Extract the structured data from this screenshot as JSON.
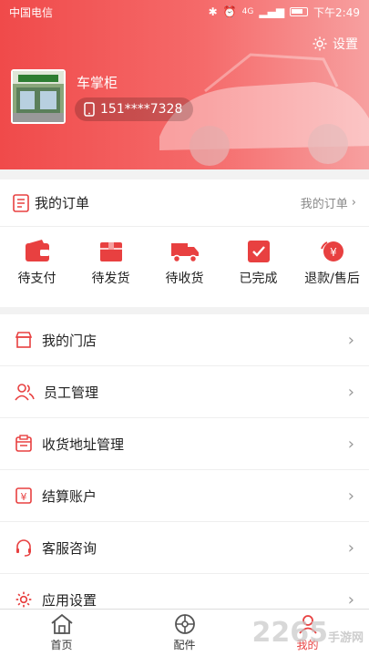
{
  "colors": {
    "accent": "#e84040",
    "header_start": "#f04a4a",
    "header_end": "#f7a0a0"
  },
  "status_bar": {
    "carrier": "中国电信",
    "time": "下午2:49",
    "network": "4G"
  },
  "header": {
    "settings_label": "设置",
    "shop_name": "车掌柜",
    "phone": "151****7328"
  },
  "orders": {
    "title": "我的订单",
    "link_label": "我的订单",
    "items": [
      {
        "label": "待支付",
        "icon": "wallet-icon"
      },
      {
        "label": "待发货",
        "icon": "box-icon"
      },
      {
        "label": "待收货",
        "icon": "truck-icon"
      },
      {
        "label": "已完成",
        "icon": "check-icon"
      },
      {
        "label": "退款/售后",
        "icon": "refund-icon"
      }
    ]
  },
  "menu": {
    "items": [
      {
        "label": "我的门店",
        "icon": "store-icon"
      },
      {
        "label": "员工管理",
        "icon": "staff-icon"
      },
      {
        "label": "收货地址管理",
        "icon": "address-icon"
      },
      {
        "label": "结算账户",
        "icon": "account-icon"
      },
      {
        "label": "客服咨询",
        "icon": "headset-icon"
      },
      {
        "label": "应用设置",
        "icon": "gear-icon"
      }
    ]
  },
  "tabbar": {
    "items": [
      {
        "label": "首页",
        "icon": "home-icon"
      },
      {
        "label": "配件",
        "icon": "wheel-icon"
      },
      {
        "label": "我的",
        "icon": "user-icon",
        "active": true
      }
    ]
  },
  "watermark": {
    "number": "2265",
    "suffix": "手游网"
  }
}
